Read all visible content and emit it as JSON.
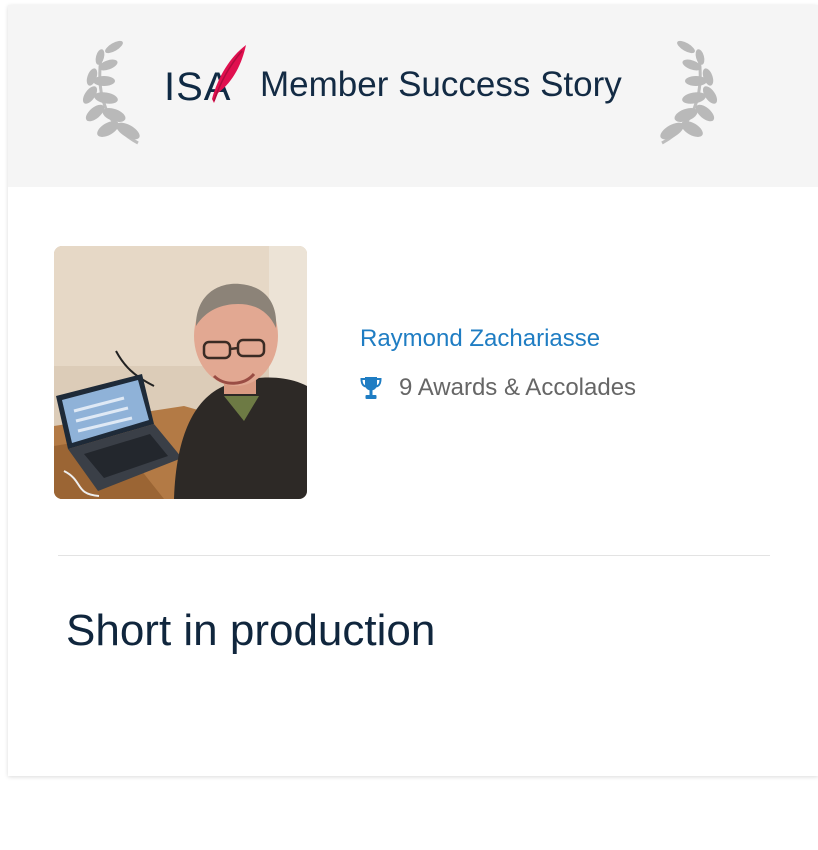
{
  "banner": {
    "logo_text": "ISA",
    "title": "Member Success Story"
  },
  "member": {
    "name": "Raymond Zachariasse",
    "awards": "9 Awards & Accolades",
    "photo_icon": "member-photo",
    "awards_icon": "trophy-icon"
  },
  "story": {
    "title": "Short in production"
  },
  "colors": {
    "banner_bg": "#f5f5f5",
    "name_link": "#1f7dc3",
    "title_text": "#10263d",
    "logo_quill": "#e0104f",
    "muted_text": "#666666"
  }
}
